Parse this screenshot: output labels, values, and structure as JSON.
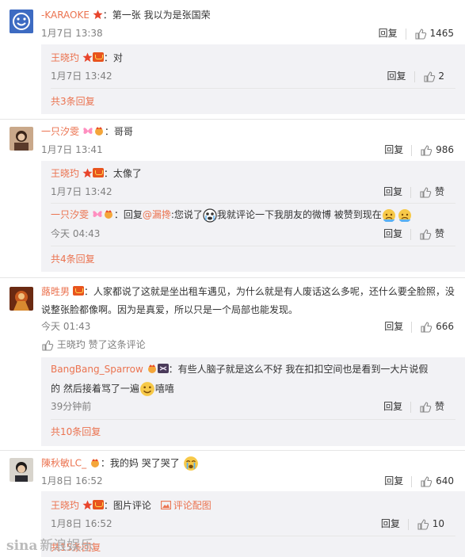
{
  "comments": [
    {
      "user": "-KARAOKE",
      "separator": "：",
      "text": "第一张 我以为是张国荣",
      "time": "1月7日 13:38",
      "reply_label": "回复",
      "like_count": "1465",
      "replies": [
        {
          "user": "王晓玓",
          "separator": "：",
          "text": "对",
          "time": "1月7日 13:42",
          "reply_label": "回复",
          "like_count": "2"
        }
      ],
      "more": "共3条回复"
    },
    {
      "user": "一只汐雯",
      "separator": "：",
      "text": "哥哥",
      "time": "1月7日 13:41",
      "reply_label": "回复",
      "like_count": "986",
      "replies": [
        {
          "user": "王晓玓",
          "separator": "：",
          "text": "太像了",
          "time": "1月7日 13:42",
          "reply_label": "回复",
          "like_count": "赞"
        },
        {
          "user": "一只汐雯",
          "separator": "：",
          "text_prefix": "回复",
          "mention": "@漏搀",
          "text": ":您说了",
          "text2": "我就评论一下我朋友的微博 被赞到现在",
          "time": "今天 04:43",
          "reply_label": "回复",
          "like_count": "赞"
        }
      ],
      "more": "共4条回复"
    },
    {
      "user": "蕗甠男",
      "separator": "：",
      "text": "人家都说了这就是坐出租车遇见，为什么就是有人废话这么多呢，还什么要全脸照，没",
      "text_line2": "说整张脸都像啊。因为是真爱，所以只是一个局部也能发现。",
      "time": "今天 01:43",
      "reply_label": "回复",
      "like_count": "666",
      "liked_by": "王晓玓 赞了这条评论",
      "replies": [
        {
          "user": "BangBang_Sparrow",
          "separator": "：",
          "text": "有些人脑子就是这么不好  我在扣扣空间也是看到一大片说假",
          "text_line2": "的  然后接着骂了一遍",
          "text_line2_tail": "嘻嘻",
          "time": "39分钟前",
          "reply_label": "回复",
          "like_count": "赞"
        }
      ],
      "more": "共10条回复"
    },
    {
      "user": "陳秋敏LC_",
      "separator": "：",
      "text": "我的妈 哭了哭了",
      "time": "1月8日 16:52",
      "reply_label": "回复",
      "like_count": "640",
      "replies": [
        {
          "user": "王晓玓",
          "separator": "：",
          "text": "图片评论",
          "link": "评论配图",
          "time": "1月8日 16:52",
          "reply_label": "回复",
          "like_count": "10"
        }
      ],
      "more": "共15条回复"
    }
  ],
  "watermark": {
    "brand": "sina",
    "cn": "新浪娱乐"
  },
  "colors": {
    "username": "#eb7350",
    "text": "#333333",
    "meta": "#808080",
    "reply_bg": "#f2f2f5",
    "accent": "#eb7350"
  }
}
